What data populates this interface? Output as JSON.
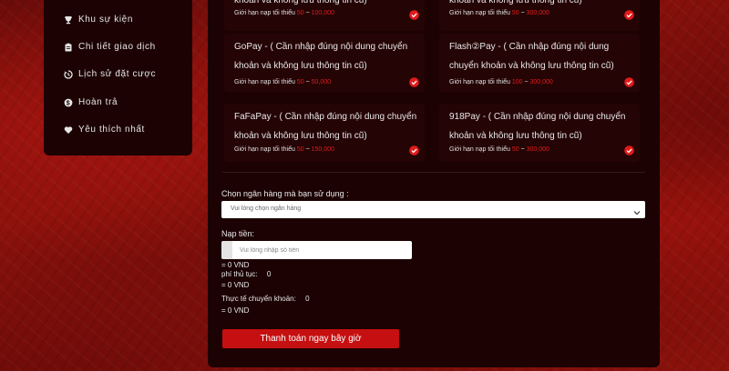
{
  "sidebar": {
    "items": [
      {
        "label": "Khu sự kiện",
        "icon": "trophy-icon"
      },
      {
        "label": "Chi tiết giao dịch",
        "icon": "clipboard-icon"
      },
      {
        "label": "Lịch sử đặt cược",
        "icon": "history-icon"
      },
      {
        "label": "Hoàn trả",
        "icon": "dollar-icon"
      },
      {
        "label": "Yêu thích nhất",
        "icon": "heart-icon"
      }
    ]
  },
  "methods": {
    "top_left": {
      "title_partial": "khoản và không lưu thông tin cũ)",
      "limit_label": "Giới hạn nạp tối thiểu",
      "min": "50",
      "sep": "~",
      "max": "100,000"
    },
    "top_right": {
      "title_partial": "khoản và không lưu thông tin cũ)",
      "limit_label": "Giới hạn nạp tối thiểu",
      "min": "50",
      "sep": "~",
      "max": "300,000"
    },
    "gopay": {
      "title": "GoPay - ( Cần nhập đúng nội dung chuyển khoản và không lưu thông tin cũ)",
      "limit_label": "Giới hạn nạp tối thiểu",
      "min": "50",
      "sep": "~",
      "max": "50,000"
    },
    "flashpay": {
      "title": "Flash②Pay - ( Cần nhập đúng nội dung chuyển khoản và không lưu thông tin cũ)",
      "limit_label": "Giới hạn nạp tối thiểu",
      "min": "100",
      "sep": "~",
      "max": "300,000"
    },
    "fafapay": {
      "title": "FaFaPay - ( Cần nhập đúng nội dung chuyển khoản và không lưu thông tin cũ)",
      "limit_label": "Giới hạn nạp tối thiểu",
      "min": "50",
      "sep": "~",
      "max": "150,000"
    },
    "pay918": {
      "title": "918Pay - ( Cần nhập đúng nội dung chuyển khoản và không lưu thông tin cũ)",
      "limit_label": "Giới hạn nạp tối thiểu",
      "min": "50",
      "sep": "~",
      "max": "300,000"
    }
  },
  "bank": {
    "label": "Chọn ngân hàng mà bạn sử dụng :",
    "placeholder": "Vui lòng chọn ngân hàng"
  },
  "deposit": {
    "label": "Nạp tiền:",
    "placeholder": "Vui lòng nhập số tiền",
    "converted": "= 0 VND",
    "fee_label": "phí thủ tục:",
    "fee_value": "0",
    "fee_converted": "= 0 VND",
    "actual_label": "Thực tế chuyển khoản:",
    "actual_value": "0",
    "actual_converted": "= 0 VND"
  },
  "pay_button": "Thanh toán ngay bây giờ",
  "colors": {
    "accent": "#c60f10",
    "limit_red": "#e11b1b",
    "panel": "#1c0203"
  }
}
